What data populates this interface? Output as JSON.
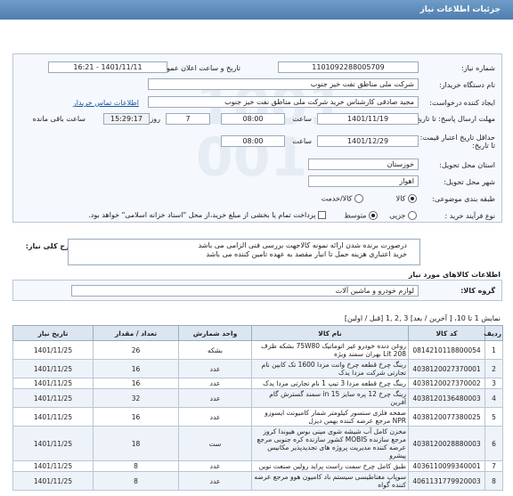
{
  "header": {
    "title": "جزئیات اطلاعات نیاز"
  },
  "details": {
    "need_number_label": "شماره نیاز:",
    "need_number": "1101092288005709",
    "announce_label": "تاریخ و ساعت اعلان عمومی:",
    "announce_value": "1401/11/11 - 16:21",
    "buyer_label": "نام دستگاه خریدار:",
    "buyer_value": "شرکت ملی مناطق نفت خیز جنوب",
    "creator_label": "ایجاد کننده درخواست:",
    "creator_value": "مجید صادقی  کارشناس خرید  شرکت ملی مناطق نفت خیز جنوب",
    "contact_link": "اطلاعات تماس خریدار",
    "send_deadline_label": "مهلت ارسال پاسخ: تا تاریخ:",
    "send_date": "1401/11/19",
    "time_label": "ساعت",
    "send_time": "08:00",
    "days_value": "7",
    "days_label": "روز و",
    "remaining_time": "15:29:17",
    "remaining_label": "ساعت باقی مانده",
    "validity_label": "حداقل تاریخ اعتبار قیمت: تا تاریخ:",
    "validity_date": "1401/12/29",
    "validity_time": "08:00",
    "province_label": "استان محل تحویل:",
    "province_value": "خوزستان",
    "city_label": "شهر محل تحویل:",
    "city_value": "اهواز",
    "category_label": "طبقه بندی موضوعی:",
    "category_opt1": "کالا",
    "category_opt2": "کالا/خدمت",
    "process_label": "نوع فرآیند خرید :",
    "process_opt1": "جزیی",
    "process_opt2": "متوسط",
    "payment_note": "پرداخت تمام یا بخشی از مبلغ خرید،از محل \"اسناد خزانه اسلامی\" خواهد بود."
  },
  "description": {
    "label": "شرح کلی نیاز:",
    "line1": "درصورت برنده شدن ارائه نمونه کالاجهت بررسی فنی الزامی می باشد",
    "line2": "خرید اعتباری هزینه حمل تا انبار مقصد به عهده تامین کننده می باشد"
  },
  "goods": {
    "title": "اطلاعات کالاهای مورد نیاز",
    "group_label": "گروه کالا:",
    "group_value": "لوازم خودرو و ماشین آلات"
  },
  "pager": {
    "text": "نمایش 1 تا 10، [ آخرین / بعد] 3 ,2 ,1 [قبل / اولین]"
  },
  "table": {
    "headers": [
      "ردیف",
      "کد کالا",
      "نام کالا",
      "واحد شمارش",
      "تعداد / مقدار",
      "تاریخ نیاز"
    ],
    "rows": [
      [
        "1",
        "0814210118800054",
        "روغن دنده خودرو غیر اتوماتیک 75W80 بشکه ظرف 208 Lit بهران سمند ویژه",
        "بشکه",
        "26",
        "1401/11/25"
      ],
      [
        "2",
        "4038120027370001",
        "رینگ چرخ قطعه چرخ وانت مزدا 1600 تک کابین نام تجارتی شرکت مزدا یدک",
        "عدد",
        "16",
        "1401/11/25"
      ],
      [
        "3",
        "4038120027370002",
        "رینگ چرخ قطعه مزدا 3 تیپ 1 نام تجارتی مزدا یدک",
        "عدد",
        "16",
        "1401/11/25"
      ],
      [
        "4",
        "4038120136480003",
        "رینگ چرخ 12 پره سایز 15 in سمند گسترش گام آفرین",
        "عدد",
        "32",
        "1401/11/25"
      ],
      [
        "5",
        "4038120077380025",
        "صفحه فلزی سنسور کیلومتر شمار کامیونت ایسوزو NPR مرجع عرضه کننده بهمن دیزل",
        "عدد",
        "16",
        "1401/11/25"
      ],
      [
        "6",
        "4038120028880003",
        "مخزن کامل آب شیشه شوی مینی بوس هیوندا کروز مرجع سازنده MOBIS کشور سازنده کره جنوبی مرجع عرضه کننده مدیریت پروژه های تجدیدپذیر مکانیس پیشرو",
        "ست",
        "18",
        "1401/11/25"
      ],
      [
        "7",
        "4036110099340001",
        "طبق کامل چرخ سمت راست پراید رولین صنعت نوین",
        "عدد",
        "8",
        "1401/11/25"
      ],
      [
        "8",
        "4061131779920003",
        "سوپاپ مغناطیسی سیستم باد کامیون هوو مرجع عرضه کننده گواه",
        "عدد",
        "8",
        "1401/11/25"
      ]
    ]
  },
  "colors": {
    "header": "#5b8bbd",
    "link": "#1a55a0",
    "table_header": "#dce6f1"
  }
}
